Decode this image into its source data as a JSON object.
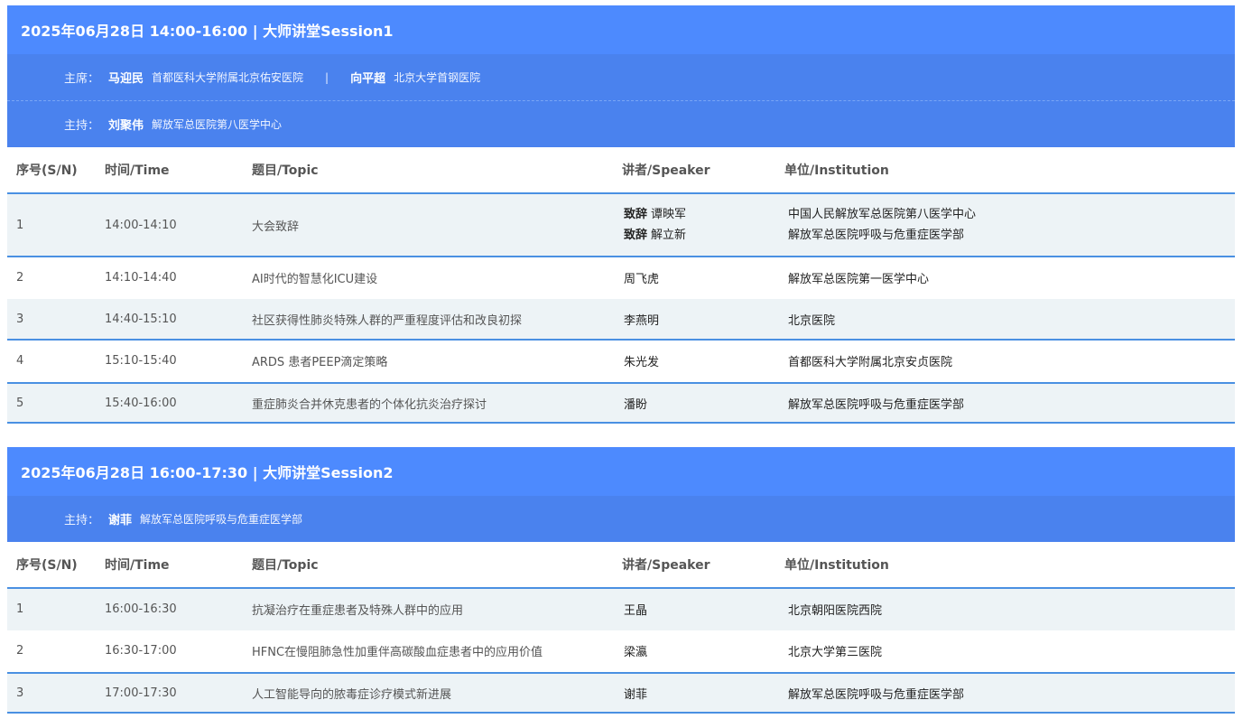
{
  "columns": {
    "sn": "序号(S/N)",
    "time": "时间/Time",
    "topic": "题目/Topic",
    "speaker": "讲者/Speaker",
    "institution": "单位/Institution"
  },
  "sessions": [
    {
      "title": "2025年06月28日 14:00-16:00 | 大师讲堂Session1",
      "chairs_label": "主席：",
      "chairs": [
        {
          "name": "马迎民",
          "org": "首都医科大学附属北京佑安医院"
        },
        {
          "name": "向平超",
          "org": "北京大学首钢医院"
        }
      ],
      "chair_separator": "|",
      "host_label": "主持：",
      "host": {
        "name": "刘聚伟",
        "org": "解放军总医院第八医学中心"
      },
      "rows": [
        {
          "sn": "1",
          "time": "14:00-14:10",
          "topic": "大会致辞",
          "speakers": [
            {
              "role": "致辞",
              "name": "谭映军",
              "inst": "中国人民解放军总医院第八医学中心"
            },
            {
              "role": "致辞",
              "name": "解立新",
              "inst": "解放军总医院呼吸与危重症医学部"
            }
          ]
        },
        {
          "sn": "2",
          "time": "14:10-14:40",
          "topic": "AI时代的智慧化ICU建设",
          "speaker": "周飞虎",
          "inst": "解放军总医院第一医学中心"
        },
        {
          "sn": "3",
          "time": "14:40-15:10",
          "topic": "社区获得性肺炎特殊人群的严重程度评估和改良初探",
          "speaker": "李燕明",
          "inst": "北京医院"
        },
        {
          "sn": "4",
          "time": "15:10-15:40",
          "topic": "ARDS 患者PEEP滴定策略",
          "speaker": "朱光发",
          "inst": "首都医科大学附属北京安贞医院"
        },
        {
          "sn": "5",
          "time": "15:40-16:00",
          "topic": "重症肺炎合并休克患者的个体化抗炎治疗探讨",
          "speaker": "潘盼",
          "inst": "解放军总医院呼吸与危重症医学部"
        }
      ]
    },
    {
      "title": "2025年06月28日 16:00-17:30 | 大师讲堂Session2",
      "host_label": "主持：",
      "host": {
        "name": "谢菲",
        "org": "解放军总医院呼吸与危重症医学部"
      },
      "rows": [
        {
          "sn": "1",
          "time": "16:00-16:30",
          "topic": "抗凝治疗在重症患者及特殊人群中的应用",
          "speaker": "王晶",
          "inst": "北京朝阳医院西院"
        },
        {
          "sn": "2",
          "time": "16:30-17:00",
          "topic": "HFNC在慢阻肺急性加重伴高碳酸血症患者中的应用价值",
          "speaker": "梁瀛",
          "inst": "北京大学第三医院"
        },
        {
          "sn": "3",
          "time": "17:00-17:30",
          "topic": "人工智能导向的脓毒症诊疗模式新进展",
          "speaker": "谢菲",
          "inst": "解放军总医院呼吸与危重症医学部"
        }
      ]
    }
  ],
  "colors": {
    "header_bg": "#4d8afe",
    "role_bg": "#4a82ee",
    "row_shade": "#edf3f6",
    "rule": "#4a90e2"
  }
}
